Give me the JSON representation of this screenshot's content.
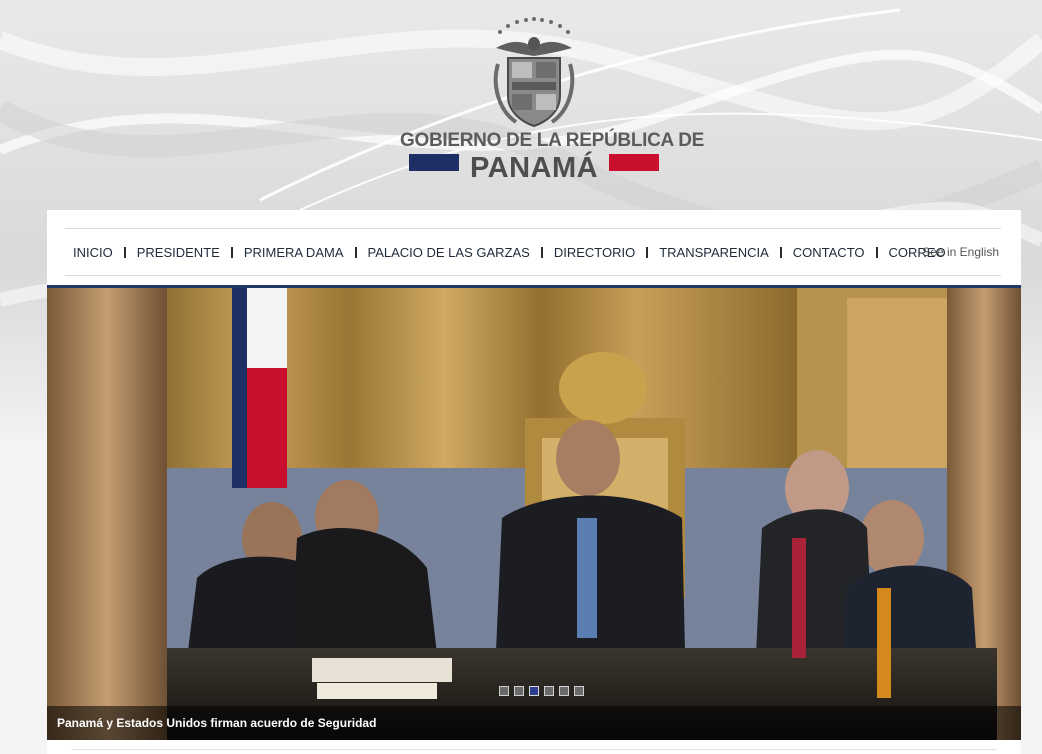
{
  "header": {
    "logo_line1": "GOBIERNO DE LA REPÚBLICA DE",
    "logo_line2": "PANAMÁ",
    "seal_icon": "panama-coat-of-arms-icon",
    "flag_colors": {
      "blue": "#1e2f66",
      "red": "#c8102e"
    }
  },
  "nav": {
    "items": [
      {
        "label": "INICIO"
      },
      {
        "label": "PRESIDENTE"
      },
      {
        "label": "PRIMERA DAMA"
      },
      {
        "label": "PALACIO DE LAS GARZAS"
      },
      {
        "label": "DIRECTORIO"
      },
      {
        "label": "TRANSPARENCIA"
      },
      {
        "label": "CONTACTO"
      },
      {
        "label": "CORREO"
      }
    ],
    "language_link": "See in English"
  },
  "slider": {
    "caption": "Panamá y Estados Unidos firman acuerdo de Seguridad",
    "slide_count": 6,
    "active_slide": 3,
    "accent_color": "#203a66"
  }
}
